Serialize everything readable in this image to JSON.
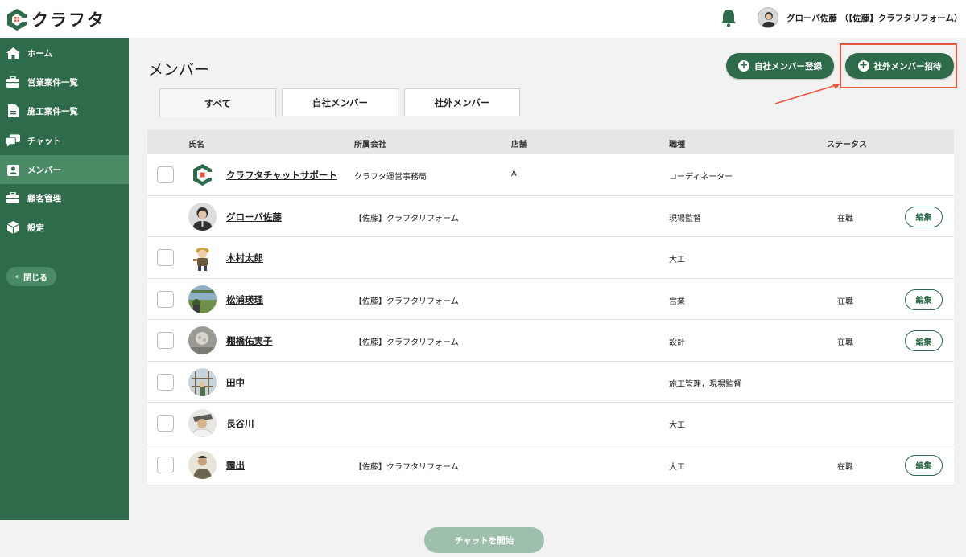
{
  "app": {
    "logo_text": "クラフタ"
  },
  "header": {
    "user_name": "グローバ佐藤 （【佐藤】クラフタリフォーム）"
  },
  "sidebar": {
    "items": [
      {
        "label": "ホーム",
        "icon": "home-icon"
      },
      {
        "label": "営業案件一覧",
        "icon": "briefcase-icon"
      },
      {
        "label": "施工案件一覧",
        "icon": "document-icon"
      },
      {
        "label": "チャット",
        "icon": "chat-icon"
      },
      {
        "label": "メンバー",
        "icon": "member-icon",
        "active": true
      },
      {
        "label": "顧客管理",
        "icon": "briefcase-icon"
      },
      {
        "label": "設定",
        "icon": "cube-icon"
      }
    ],
    "close_label": "閉じる"
  },
  "main": {
    "title": "メンバー",
    "register_label": "自社メンバー登録",
    "invite_label": "社外メンバー招待",
    "tabs": [
      {
        "label": "すべて",
        "active": true
      },
      {
        "label": "自社メンバー"
      },
      {
        "label": "社外メンバー"
      }
    ],
    "columns": [
      "氏名",
      "所属会社",
      "店舗",
      "職種",
      "ステータス"
    ],
    "rows": [
      {
        "name": "クラフタチャットサポート",
        "company": "クラフタ運営事務局",
        "store": "A",
        "job": "コーディネーター",
        "status": "",
        "edit": "",
        "checkbox": true
      },
      {
        "name": "グローバ佐藤",
        "company": "【佐藤】クラフタリフォーム",
        "store": "",
        "job": "現場監督",
        "status": "在職",
        "edit": "編集",
        "checkbox": false
      },
      {
        "name": "木村太郎",
        "company": "",
        "store": "",
        "job": "大工",
        "status": "",
        "edit": "",
        "checkbox": true
      },
      {
        "name": "松浦瑛理",
        "company": "【佐藤】クラフタリフォーム",
        "store": "",
        "job": "営業",
        "status": "在職",
        "edit": "編集",
        "checkbox": true
      },
      {
        "name": "棚橋佑実子",
        "company": "【佐藤】クラフタリフォーム",
        "store": "",
        "job": "設計",
        "status": "在職",
        "edit": "編集",
        "checkbox": true
      },
      {
        "name": "田中",
        "company": "",
        "store": "",
        "job": "施工管理，現場監督",
        "status": "",
        "edit": "",
        "checkbox": true
      },
      {
        "name": "長谷川",
        "company": "",
        "store": "",
        "job": "大工",
        "status": "",
        "edit": "",
        "checkbox": true
      },
      {
        "name": "霜出",
        "company": "【佐藤】クラフタリフォーム",
        "store": "",
        "job": "大工",
        "status": "在職",
        "edit": "編集",
        "checkbox": true
      }
    ],
    "chat_start_label": "チャットを開始"
  },
  "colors": {
    "brand": "#2e6b4a",
    "sidebar_active": "#4a8a64",
    "annotation": "#e8553c"
  }
}
